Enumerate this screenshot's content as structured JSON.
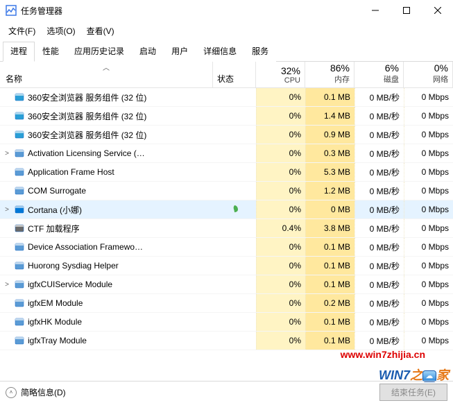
{
  "window": {
    "title": "任务管理器"
  },
  "menu": {
    "file": "文件(F)",
    "options": "选项(O)",
    "view": "查看(V)"
  },
  "tabs": {
    "processes": "进程",
    "performance": "性能",
    "history": "应用历史记录",
    "startup": "启动",
    "users": "用户",
    "details": "详细信息",
    "services": "服务"
  },
  "columns": {
    "name": "名称",
    "status": "状态",
    "cpu": {
      "pct": "32%",
      "label": "CPU"
    },
    "memory": {
      "pct": "86%",
      "label": "内存"
    },
    "disk": {
      "pct": "6%",
      "label": "磁盘"
    },
    "network": {
      "pct": "0%",
      "label": "网络"
    }
  },
  "rows": [
    {
      "icon": "#2a9fd6",
      "name": "360安全浏览器 服务组件 (32 位)",
      "expand": "",
      "leaf": false,
      "cpu": "0%",
      "mem": "0.1 MB",
      "disk": "0 MB/秒",
      "net": "0 Mbps",
      "cpu_h": "heat",
      "mem_h": "heat-med"
    },
    {
      "icon": "#2a9fd6",
      "name": "360安全浏览器 服务组件 (32 位)",
      "expand": "",
      "leaf": false,
      "cpu": "0%",
      "mem": "1.4 MB",
      "disk": "0 MB/秒",
      "net": "0 Mbps",
      "cpu_h": "heat",
      "mem_h": "heat-med"
    },
    {
      "icon": "#2a9fd6",
      "name": "360安全浏览器 服务组件 (32 位)",
      "expand": "",
      "leaf": false,
      "cpu": "0%",
      "mem": "0.9 MB",
      "disk": "0 MB/秒",
      "net": "0 Mbps",
      "cpu_h": "heat",
      "mem_h": "heat-med"
    },
    {
      "icon": "#5b9bd5",
      "name": "Activation Licensing Service (…",
      "expand": ">",
      "leaf": false,
      "cpu": "0%",
      "mem": "0.3 MB",
      "disk": "0 MB/秒",
      "net": "0 Mbps",
      "cpu_h": "heat",
      "mem_h": "heat-med"
    },
    {
      "icon": "#5b9bd5",
      "name": "Application Frame Host",
      "expand": "",
      "leaf": false,
      "cpu": "0%",
      "mem": "5.3 MB",
      "disk": "0 MB/秒",
      "net": "0 Mbps",
      "cpu_h": "heat",
      "mem_h": "heat-med"
    },
    {
      "icon": "#5b9bd5",
      "name": "COM Surrogate",
      "expand": "",
      "leaf": false,
      "cpu": "0%",
      "mem": "1.2 MB",
      "disk": "0 MB/秒",
      "net": "0 Mbps",
      "cpu_h": "heat",
      "mem_h": "heat-med"
    },
    {
      "icon": "#0078d7",
      "name": "Cortana (小娜)",
      "expand": ">",
      "leaf": true,
      "selected": true,
      "cpu": "0%",
      "mem": "0 MB",
      "disk": "0 MB/秒",
      "net": "0 Mbps",
      "cpu_h": "heat",
      "mem_h": "heat-med"
    },
    {
      "icon": "#6a6a6a",
      "name": "CTF 加载程序",
      "expand": "",
      "leaf": false,
      "cpu": "0.4%",
      "mem": "3.8 MB",
      "disk": "0 MB/秒",
      "net": "0 Mbps",
      "cpu_h": "heat",
      "mem_h": "heat-med"
    },
    {
      "icon": "#5b9bd5",
      "name": "Device Association Framewo…",
      "expand": "",
      "leaf": false,
      "cpu": "0%",
      "mem": "0.1 MB",
      "disk": "0 MB/秒",
      "net": "0 Mbps",
      "cpu_h": "heat",
      "mem_h": "heat-med"
    },
    {
      "icon": "#5b9bd5",
      "name": "Huorong Sysdiag Helper",
      "expand": "",
      "leaf": false,
      "cpu": "0%",
      "mem": "0.1 MB",
      "disk": "0 MB/秒",
      "net": "0 Mbps",
      "cpu_h": "heat",
      "mem_h": "heat-med"
    },
    {
      "icon": "#5b9bd5",
      "name": "igfxCUIService Module",
      "expand": ">",
      "leaf": false,
      "cpu": "0%",
      "mem": "0.1 MB",
      "disk": "0 MB/秒",
      "net": "0 Mbps",
      "cpu_h": "heat",
      "mem_h": "heat-med"
    },
    {
      "icon": "#5b9bd5",
      "name": "igfxEM Module",
      "expand": "",
      "leaf": false,
      "cpu": "0%",
      "mem": "0.2 MB",
      "disk": "0 MB/秒",
      "net": "0 Mbps",
      "cpu_h": "heat",
      "mem_h": "heat-med"
    },
    {
      "icon": "#5b9bd5",
      "name": "igfxHK Module",
      "expand": "",
      "leaf": false,
      "cpu": "0%",
      "mem": "0.1 MB",
      "disk": "0 MB/秒",
      "net": "0 Mbps",
      "cpu_h": "heat",
      "mem_h": "heat-med"
    },
    {
      "icon": "#5b9bd5",
      "name": "igfxTray Module",
      "expand": "",
      "leaf": false,
      "cpu": "0%",
      "mem": "0.1 MB",
      "disk": "0 MB/秒",
      "net": "0 Mbps",
      "cpu_h": "heat",
      "mem_h": "heat-med"
    }
  ],
  "footer": {
    "brief": "简略信息(D)",
    "end_task": "结束任务(E)"
  },
  "watermark": {
    "url": "www.win7zhijia.cn",
    "logo_a": "WIN7",
    "logo_b": "之",
    "logo_c": "家"
  }
}
